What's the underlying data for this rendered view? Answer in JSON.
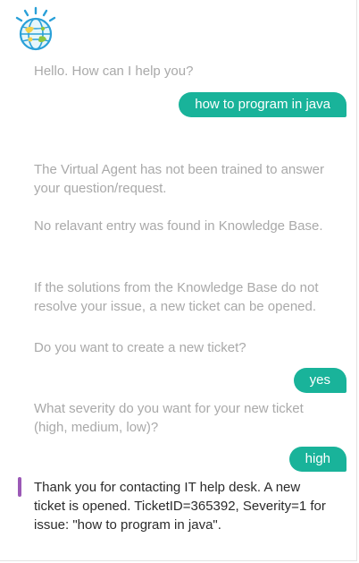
{
  "chat": {
    "greeting": "Hello. How can I help you?",
    "user_query": "how to program in java",
    "not_trained": "The Virtual Agent has not been trained to answer your question/request.",
    "no_entry": "No relavant entry was found in Knowledge Base.",
    "solutions_note": "If the solutions from the Knowledge Base do not resolve your issue, a new ticket can be opened.",
    "create_ticket_q": "Do you want to create a new ticket?",
    "user_yes": "yes",
    "severity_q": "What severity do you want for your new ticket (high, medium, low)?",
    "user_high": "high",
    "confirmation": "Thank you for contacting IT help desk. A new ticket is opened. TicketID=365392, Severity=1 for issue: \"how to program in java\"."
  },
  "colors": {
    "user_bubble": "#19b39a",
    "bot_text": "#a9a9a9",
    "latest_text": "#2b2b2b",
    "accent_bar": "#9b59b6"
  },
  "icons": {
    "logo": "globe-logo-icon"
  }
}
